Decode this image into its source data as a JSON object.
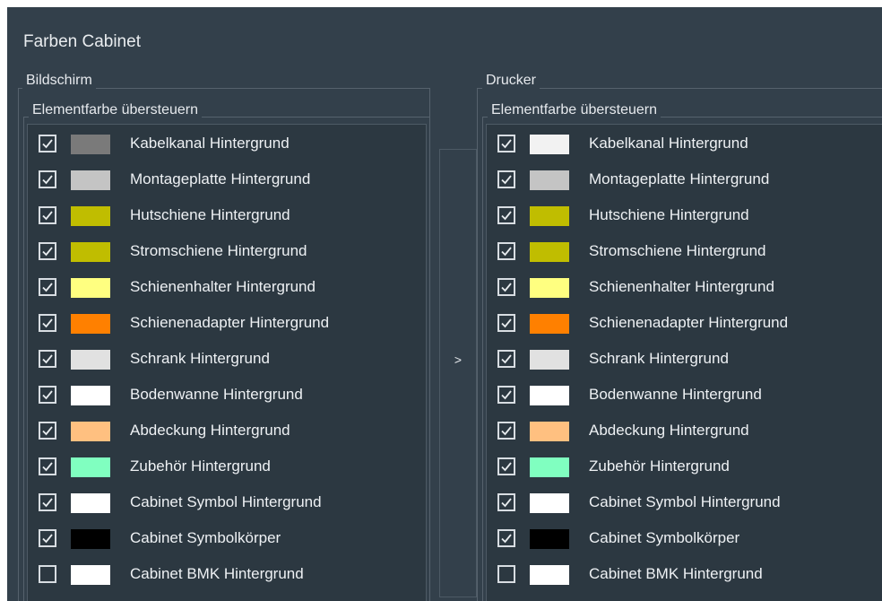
{
  "window": {
    "title": "Farben Cabinet"
  },
  "left": {
    "group_label": "Bildschirm",
    "subgroup_label": "Elementfarbe übersteuern",
    "items": [
      {
        "label": "Kabelkanal Hintergrund",
        "checked": true,
        "color": "#7a7a7a"
      },
      {
        "label": "Montageplatte Hintergrund",
        "checked": true,
        "color": "#c4c4c4"
      },
      {
        "label": "Hutschiene Hintergrund",
        "checked": true,
        "color": "#c0bd00"
      },
      {
        "label": "Stromschiene Hintergrund",
        "checked": true,
        "color": "#c0bd00"
      },
      {
        "label": "Schienenhalter Hintergrund",
        "checked": true,
        "color": "#ffff80"
      },
      {
        "label": "Schienenadapter Hintergrund",
        "checked": true,
        "color": "#ff8000"
      },
      {
        "label": "Schrank Hintergrund",
        "checked": true,
        "color": "#e1e1e1"
      },
      {
        "label": "Bodenwanne Hintergrund",
        "checked": true,
        "color": "#ffffff"
      },
      {
        "label": "Abdeckung Hintergrund",
        "checked": true,
        "color": "#ffc080"
      },
      {
        "label": "Zubehör Hintergrund",
        "checked": true,
        "color": "#80ffc0"
      },
      {
        "label": "Cabinet Symbol Hintergrund",
        "checked": true,
        "color": "#ffffff"
      },
      {
        "label": "Cabinet Symbolkörper",
        "checked": true,
        "color": "#000000"
      },
      {
        "label": "Cabinet BMK Hintergrund",
        "checked": false,
        "color": "#ffffff"
      }
    ]
  },
  "copy_button": {
    "label": ">"
  },
  "right": {
    "group_label": "Drucker",
    "subgroup_label": "Elementfarbe übersteuern",
    "items": [
      {
        "label": "Kabelkanal Hintergrund",
        "checked": true,
        "color": "#f2f2f2"
      },
      {
        "label": "Montageplatte Hintergrund",
        "checked": true,
        "color": "#c4c4c4"
      },
      {
        "label": "Hutschiene Hintergrund",
        "checked": true,
        "color": "#c0bd00"
      },
      {
        "label": "Stromschiene Hintergrund",
        "checked": true,
        "color": "#c0bd00"
      },
      {
        "label": "Schienenhalter Hintergrund",
        "checked": true,
        "color": "#ffff80"
      },
      {
        "label": "Schienenadapter Hintergrund",
        "checked": true,
        "color": "#ff8000"
      },
      {
        "label": "Schrank Hintergrund",
        "checked": true,
        "color": "#e1e1e1"
      },
      {
        "label": "Bodenwanne Hintergrund",
        "checked": true,
        "color": "#ffffff"
      },
      {
        "label": "Abdeckung Hintergrund",
        "checked": true,
        "color": "#ffc080"
      },
      {
        "label": "Zubehör Hintergrund",
        "checked": true,
        "color": "#80ffc0"
      },
      {
        "label": "Cabinet Symbol Hintergrund",
        "checked": true,
        "color": "#ffffff"
      },
      {
        "label": "Cabinet Symbolkörper",
        "checked": true,
        "color": "#000000"
      },
      {
        "label": "Cabinet BMK Hintergrund",
        "checked": false,
        "color": "#ffffff"
      }
    ]
  }
}
